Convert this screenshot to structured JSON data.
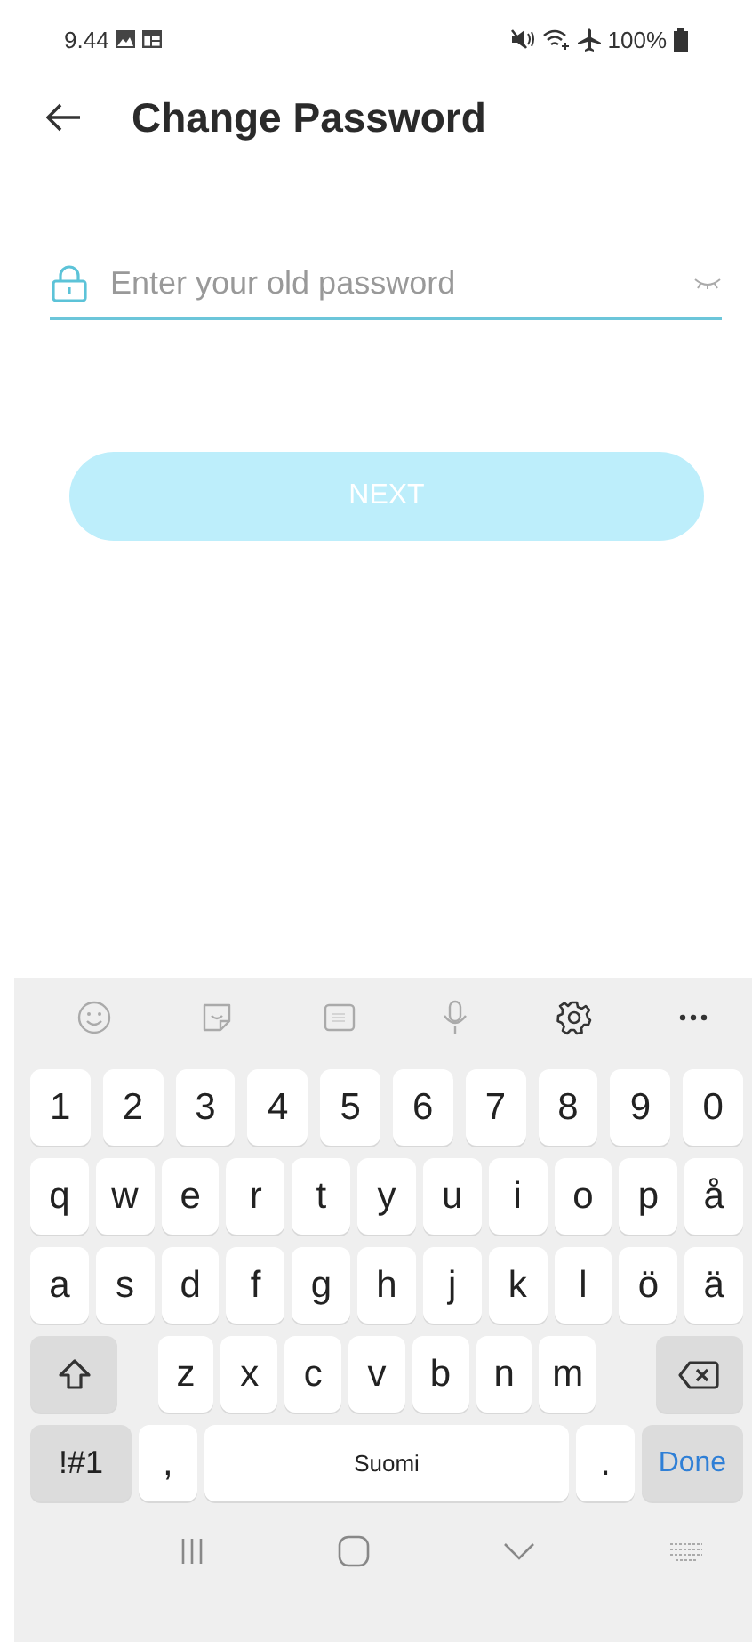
{
  "status_bar": {
    "time": "9.44",
    "battery": "100%"
  },
  "header": {
    "title": "Change Password"
  },
  "password_field": {
    "placeholder": "Enter your old password"
  },
  "next_button": {
    "label": "NEXT",
    "disabled": true
  },
  "keyboard": {
    "number_keys": [
      "1",
      "2",
      "3",
      "4",
      "5",
      "6",
      "7",
      "8",
      "9",
      "0"
    ],
    "rows": [
      [
        {
          "kind": "char",
          "label": "q"
        },
        {
          "kind": "char",
          "label": "w"
        },
        {
          "kind": "char",
          "label": "e"
        },
        {
          "kind": "char",
          "label": "r"
        },
        {
          "kind": "char",
          "label": "t"
        },
        {
          "kind": "char",
          "label": "y"
        },
        {
          "kind": "char",
          "label": "u"
        },
        {
          "kind": "char",
          "label": "i"
        },
        {
          "kind": "char",
          "label": "o"
        },
        {
          "kind": "char",
          "label": "p"
        },
        {
          "kind": "char",
          "label": "å"
        }
      ],
      [
        {
          "kind": "char",
          "label": "a"
        },
        {
          "kind": "char",
          "label": "s"
        },
        {
          "kind": "char",
          "label": "d"
        },
        {
          "kind": "char",
          "label": "f"
        },
        {
          "kind": "char",
          "label": "g"
        },
        {
          "kind": "char",
          "label": "h"
        },
        {
          "kind": "char",
          "label": "j"
        },
        {
          "kind": "char",
          "label": "k"
        },
        {
          "kind": "char",
          "label": "l"
        },
        {
          "kind": "char",
          "label": "ö"
        },
        {
          "kind": "char",
          "label": "ä"
        }
      ],
      [
        {
          "kind": "shift"
        },
        {
          "kind": "gap"
        },
        {
          "kind": "char",
          "label": "z"
        },
        {
          "kind": "char",
          "label": "x"
        },
        {
          "kind": "char",
          "label": "c"
        },
        {
          "kind": "char",
          "label": "v"
        },
        {
          "kind": "char",
          "label": "b"
        },
        {
          "kind": "char",
          "label": "n"
        },
        {
          "kind": "char",
          "label": "m"
        },
        {
          "kind": "backspace"
        }
      ]
    ],
    "bottom_keys": [
      {
        "kind": "symbols",
        "label": "!#1"
      },
      {
        "kind": "char",
        "label": ","
      },
      {
        "kind": "space",
        "label": "Suomi"
      },
      {
        "kind": "char",
        "label": "."
      },
      {
        "kind": "done",
        "label": "Done"
      }
    ]
  }
}
